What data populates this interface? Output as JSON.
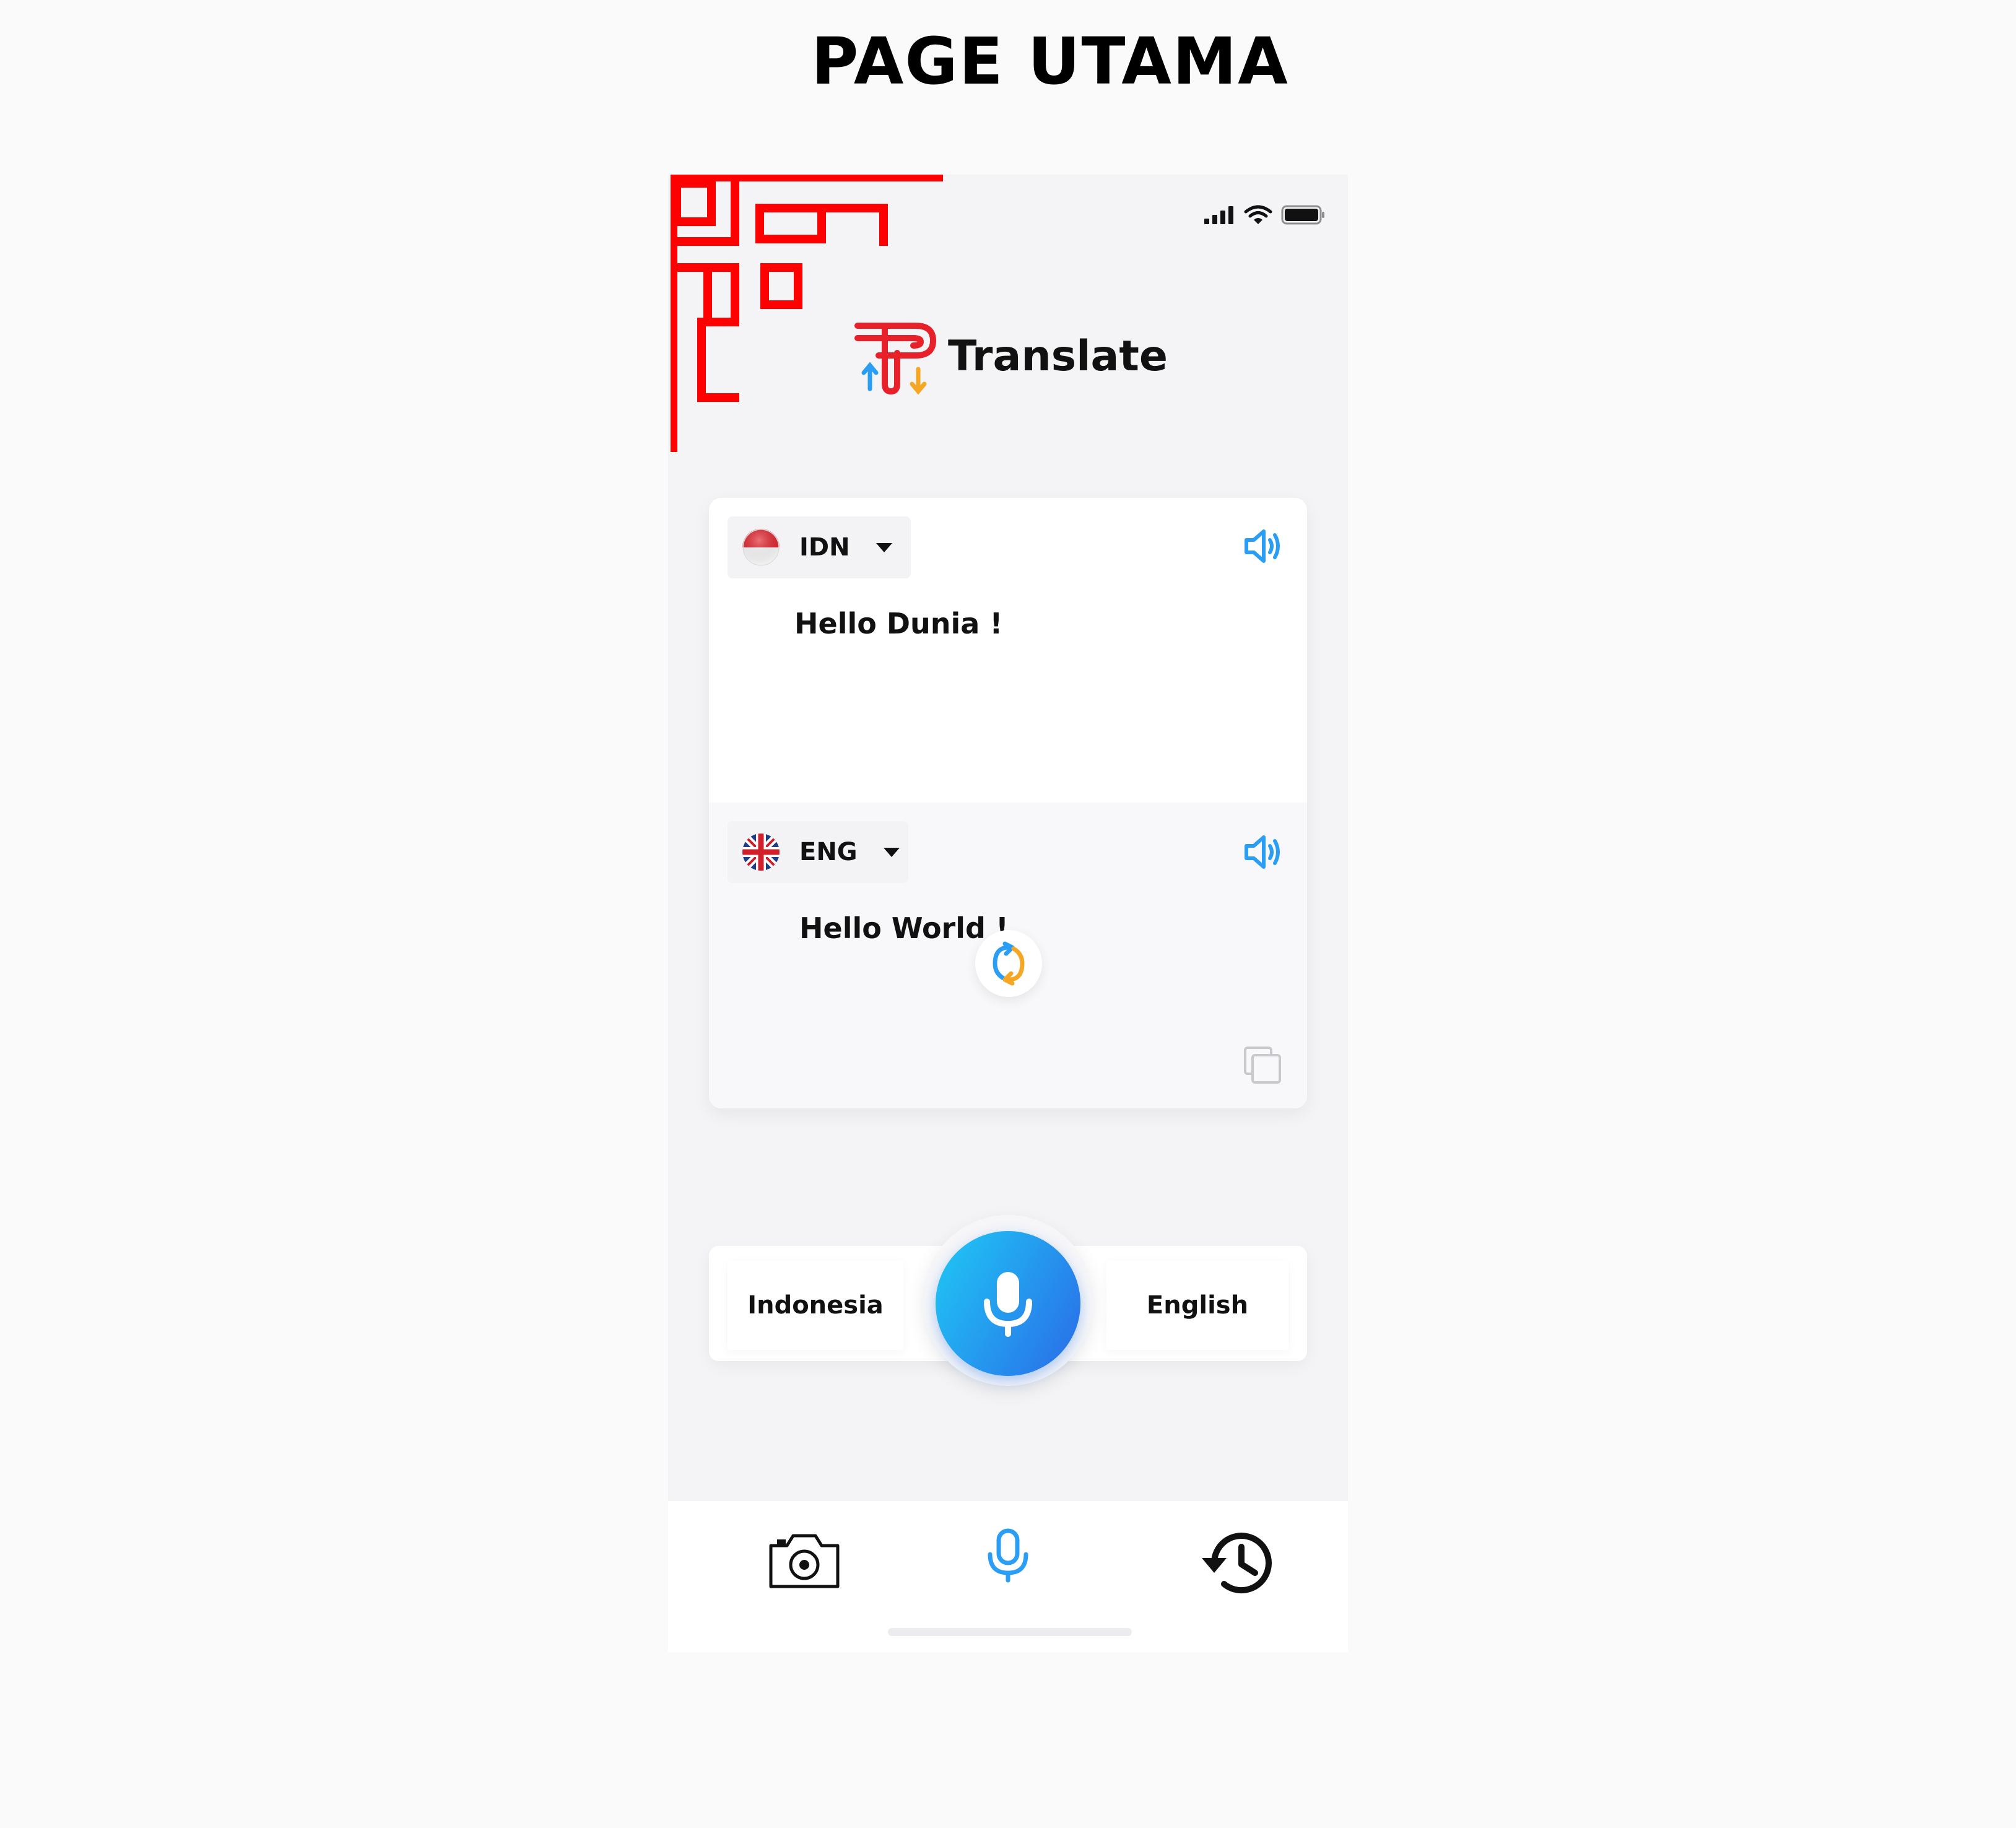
{
  "page_heading": "PAGE UTAMA",
  "app": {
    "title": "Translate"
  },
  "status_bar": {
    "icons": [
      "signal-icon",
      "wifi-icon",
      "battery-icon"
    ]
  },
  "source": {
    "code": "IDN",
    "flag": "indonesia-flag-icon",
    "text": "Hello Dunia !"
  },
  "target": {
    "code": "ENG",
    "flag": "uk-flag-icon",
    "text": "Hello World !"
  },
  "language_bar": {
    "left": "Indonesia",
    "right": "English"
  },
  "nav": {
    "items": [
      "camera-icon",
      "microphone-icon",
      "history-icon"
    ],
    "active": "microphone-icon"
  },
  "colors": {
    "accent_blue": "#2a9df4",
    "accent_orange": "#f5a623",
    "brand_red": "#e8202a",
    "ornament_red": "#ff0000",
    "mic_gradient_start": "#1fc9f5",
    "mic_gradient_end": "#2a6be8"
  }
}
